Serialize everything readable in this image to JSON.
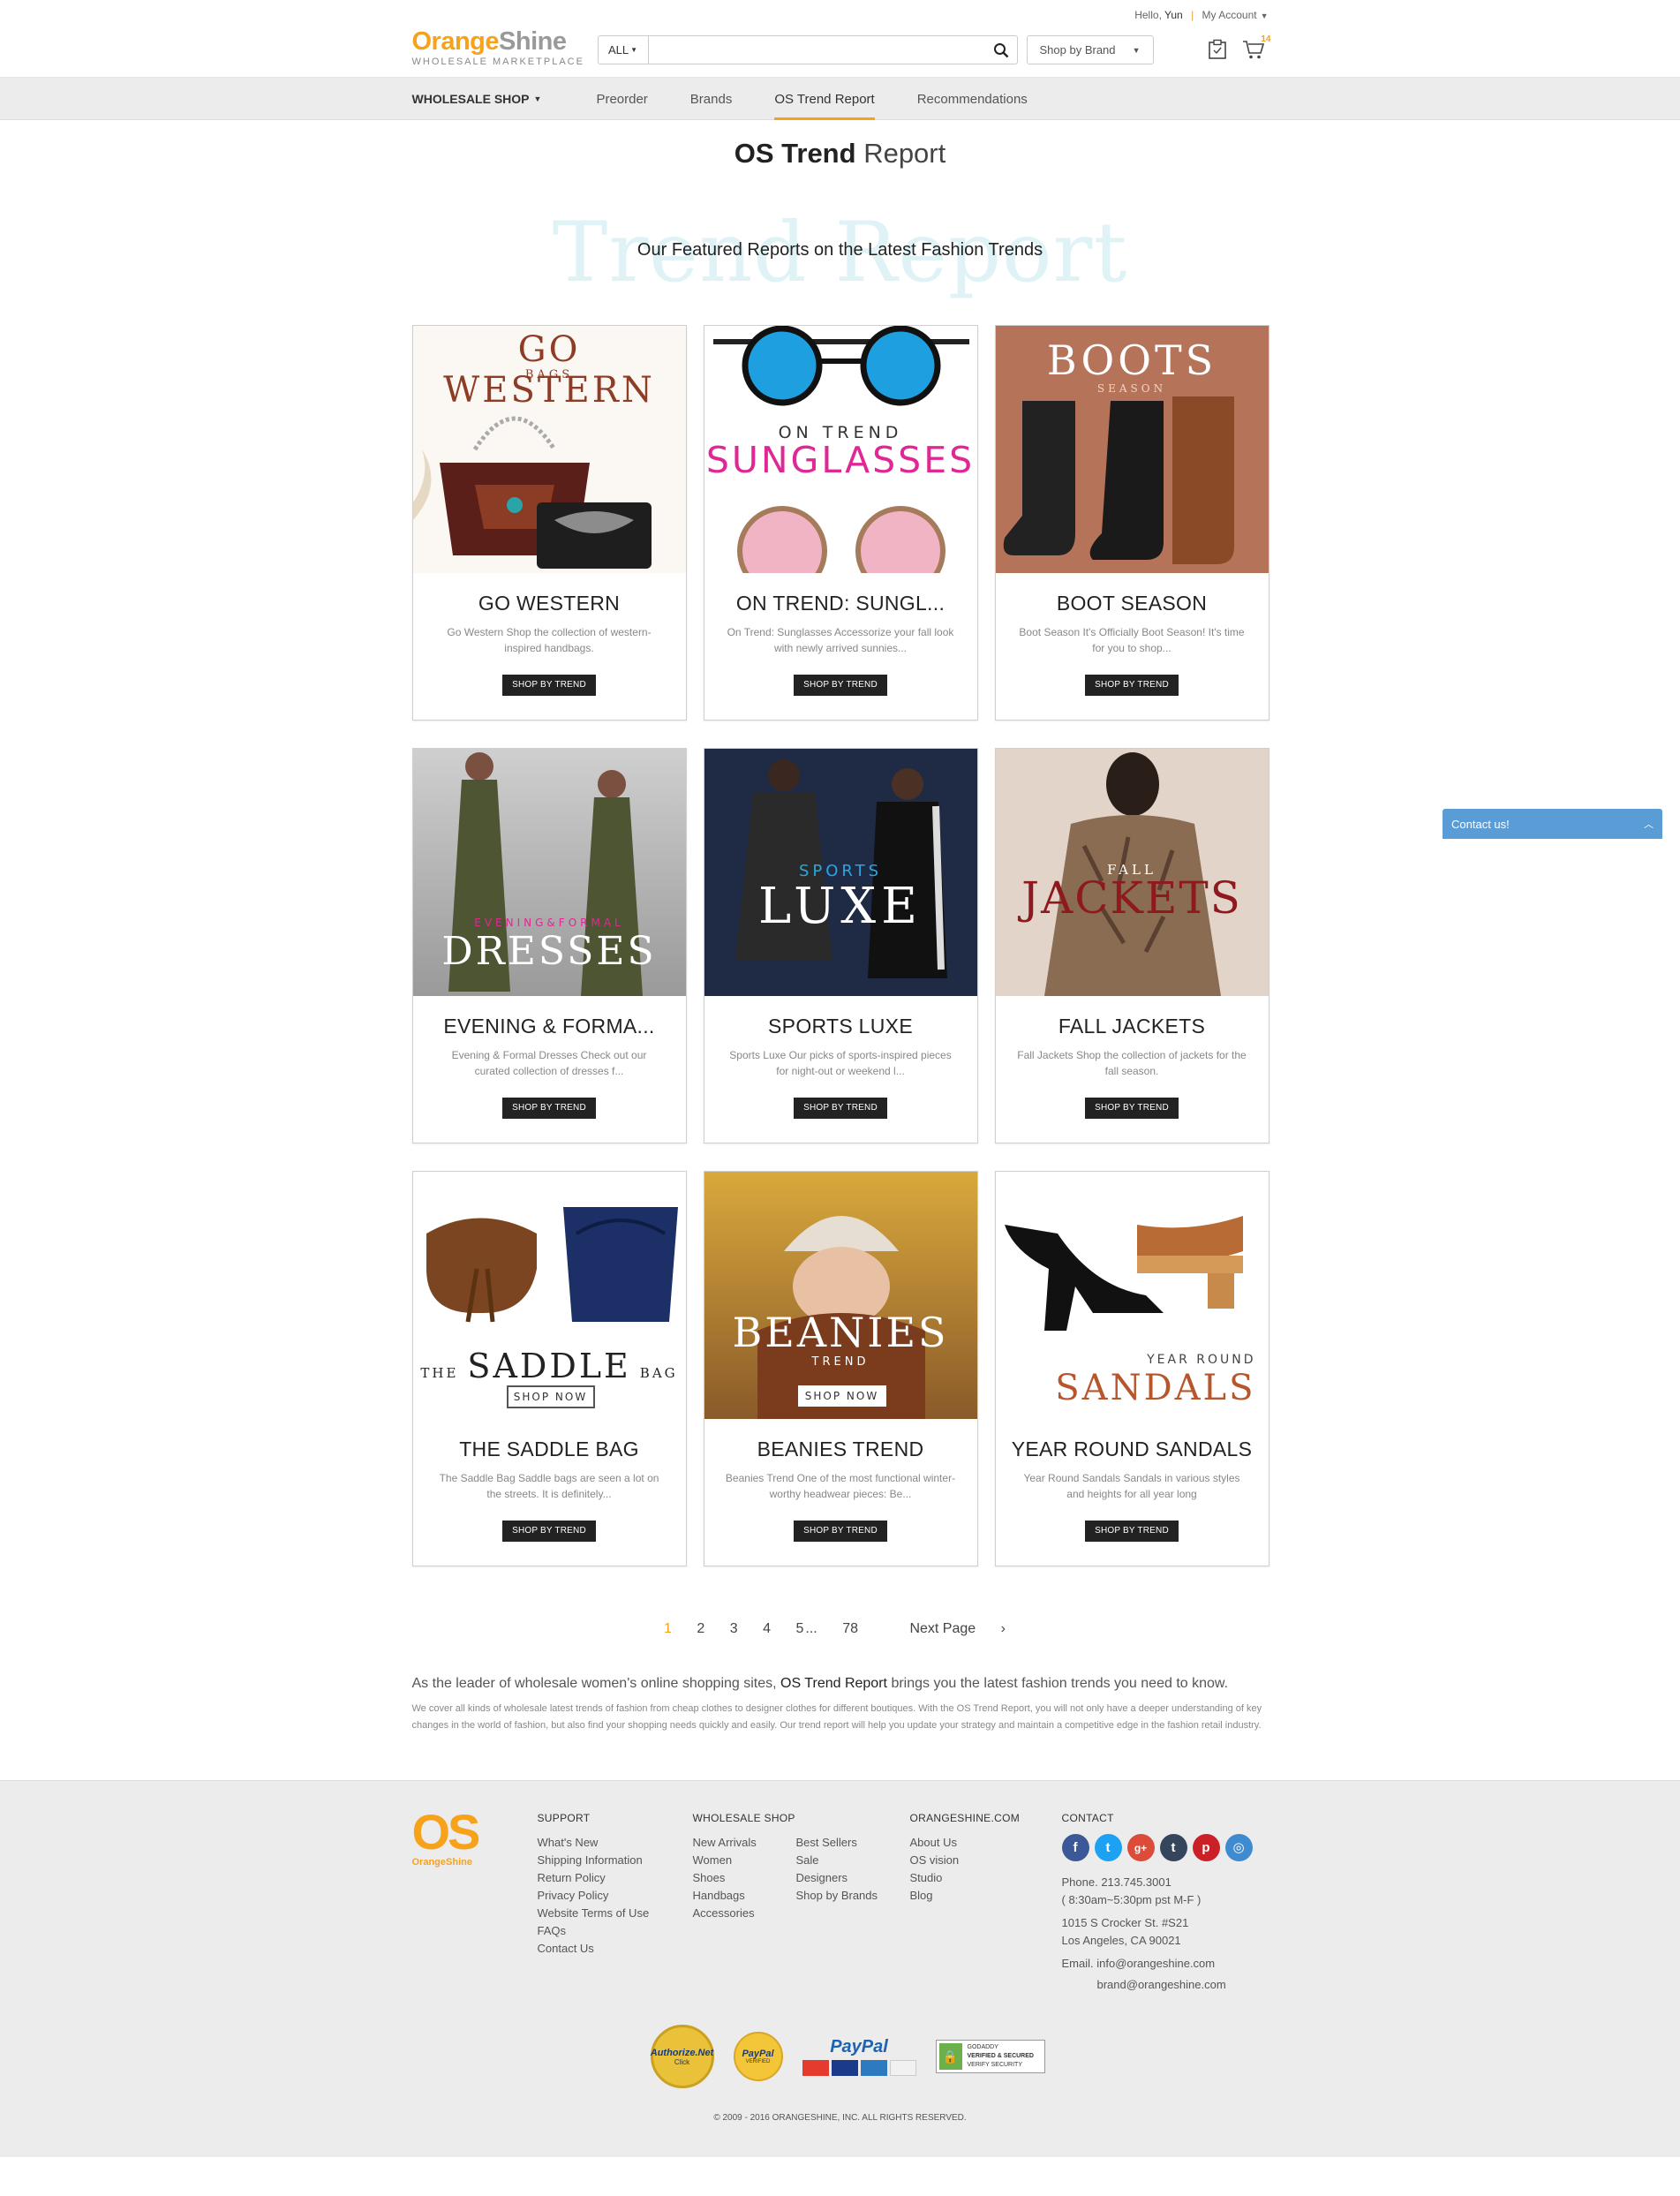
{
  "header": {
    "greeting": "Hello,",
    "user": "Yun",
    "account": "My Account",
    "logo_orange": "Orange",
    "logo_shine": "Shine",
    "logo_tagline": "WHOLESALE MARKETPLACE",
    "search_category": "ALL",
    "search_placeholder": "",
    "brand_select": "Shop by Brand",
    "cart_count": "14"
  },
  "nav": {
    "items": [
      "WHOLESALE SHOP",
      "Preorder",
      "Brands",
      "OS Trend Report",
      "Recommendations"
    ]
  },
  "page": {
    "title_bold": "OS Trend",
    "title_light": "Report",
    "ghost_text": "Trend Report",
    "subtitle": "Our Featured Reports on the Latest Fashion Trends"
  },
  "cards": [
    {
      "art_main": "GO WESTERN",
      "art_sub": "BAGS",
      "title": "GO WESTERN",
      "desc": "Go Western Shop the collection of western-inspired handbags.",
      "button": "SHOP BY TREND"
    },
    {
      "art_main": "SUNGLASSES",
      "art_sub": "ON TREND",
      "title": "ON TREND: SUNGL...",
      "desc": "On Trend: Sunglasses Accessorize your fall look with newly arrived sunnies...",
      "button": "SHOP BY TREND"
    },
    {
      "art_main": "BOOTS",
      "art_sub": "SEASON",
      "title": "BOOT SEASON",
      "desc": "Boot Season It's Officially Boot Season! It's time for you to shop...",
      "button": "SHOP BY TREND"
    },
    {
      "art_main": "DRESSES",
      "art_sub": "EVENING&FORMAL",
      "title": "EVENING & FORMA...",
      "desc": "Evening & Formal Dresses Check out our curated collection of dresses f...",
      "button": "SHOP BY TREND"
    },
    {
      "art_main": "LUXE",
      "art_sub": "SPORTS",
      "title": "SPORTS LUXE",
      "desc": "Sports Luxe Our picks of sports-inspired pieces for night-out or weekend l...",
      "button": "SHOP BY TREND"
    },
    {
      "art_main": "JACKETS",
      "art_sub": "FALL",
      "title": "FALL JACKETS",
      "desc": "Fall Jackets Shop the collection of jackets for the fall season.",
      "button": "SHOP BY TREND"
    },
    {
      "art_main": "SADDLE",
      "art_sub": "SHOP NOW",
      "title": "THE SADDLE BAG",
      "desc": "The Saddle Bag Saddle bags are seen a lot on the streets. It is definitely...",
      "button": "SHOP BY TREND"
    },
    {
      "art_main": "BEANIES",
      "art_sub": "SHOP NOW",
      "title": "BEANIES TREND",
      "desc": "Beanies Trend One of the most functional winter-worthy headwear pieces: Be...",
      "button": "SHOP BY TREND"
    },
    {
      "art_main": "SANDALS",
      "art_sub": "YEAR ROUND",
      "title": "YEAR ROUND SANDALS",
      "desc": "Year Round Sandals Sandals in various styles and heights for all year long",
      "button": "SHOP BY TREND"
    }
  ],
  "art_extras": {
    "saddle_the": "THE",
    "saddle_bag": "BAG",
    "beanies_trend": "TREND"
  },
  "pager": {
    "pages": [
      "1",
      "2",
      "3",
      "4",
      "5"
    ],
    "ellipsis": "...",
    "last": "78",
    "next": "Next Page"
  },
  "about": {
    "lead_a": "As the leader of wholesale women's online shopping sites,",
    "lead_b": "OS Trend Report",
    "lead_c": "brings you the latest fashion trends you need to know.",
    "small": "We cover all kinds of wholesale latest trends of fashion from cheap clothes to designer clothes for different boutiques. With the OS Trend Report, you will not only have a deeper understanding of key changes in the world of fashion, but also find your shopping needs quickly and easily. Our trend report will help you update your strategy and maintain a competitive edge in the fashion retail industry."
  },
  "footer": {
    "logo": "OS",
    "logo_sub": "OrangeShine",
    "support": {
      "title": "SUPPORT",
      "links": [
        "What's New",
        "Shipping Information",
        "Return Policy",
        "Privacy Policy",
        "Website Terms of Use",
        "FAQs",
        "Contact Us"
      ]
    },
    "wholesale": {
      "title": "WHOLESALE SHOP",
      "col1": [
        "New Arrivals",
        "Women",
        "Shoes",
        "Handbags",
        "Accessories"
      ],
      "col2": [
        "Best Sellers",
        "Sale",
        "Designers",
        "Shop by Brands"
      ]
    },
    "orangeshine": {
      "title": "ORANGESHINE.COM",
      "links": [
        "About Us",
        "OS vision",
        "Studio",
        "Blog"
      ]
    },
    "contact": {
      "title": "CONTACT",
      "phone": "Phone. 213.745.3001",
      "hours": "( 8:30am~5:30pm pst M-F )",
      "addr1": "1015 S Crocker St. #S21",
      "addr2": "Los Angeles, CA 90021",
      "email1": "Email. info@orangeshine.com",
      "email2": "brand@orangeshine.com"
    },
    "badges": {
      "authorize": "Authorize.Net",
      "authorize_sub": "Click",
      "paypal_seal": "PayPal",
      "paypal_seal_sub": "VERIFIED",
      "paypal": "PayPal",
      "godaddy_top": "GODADDY",
      "godaddy": "VERIFIED & SECURED",
      "godaddy_sub": "VERIFY SECURITY"
    },
    "copyright": "© 2009 - 2016 ORANGESHINE, INC. ALL RIGHTS RESERVED."
  },
  "contact_widget": {
    "label": "Contact us!"
  },
  "colors": {
    "brand": "#f7a21b",
    "nav_bg": "#ececec",
    "contact_widget": "#5a9cd6"
  }
}
